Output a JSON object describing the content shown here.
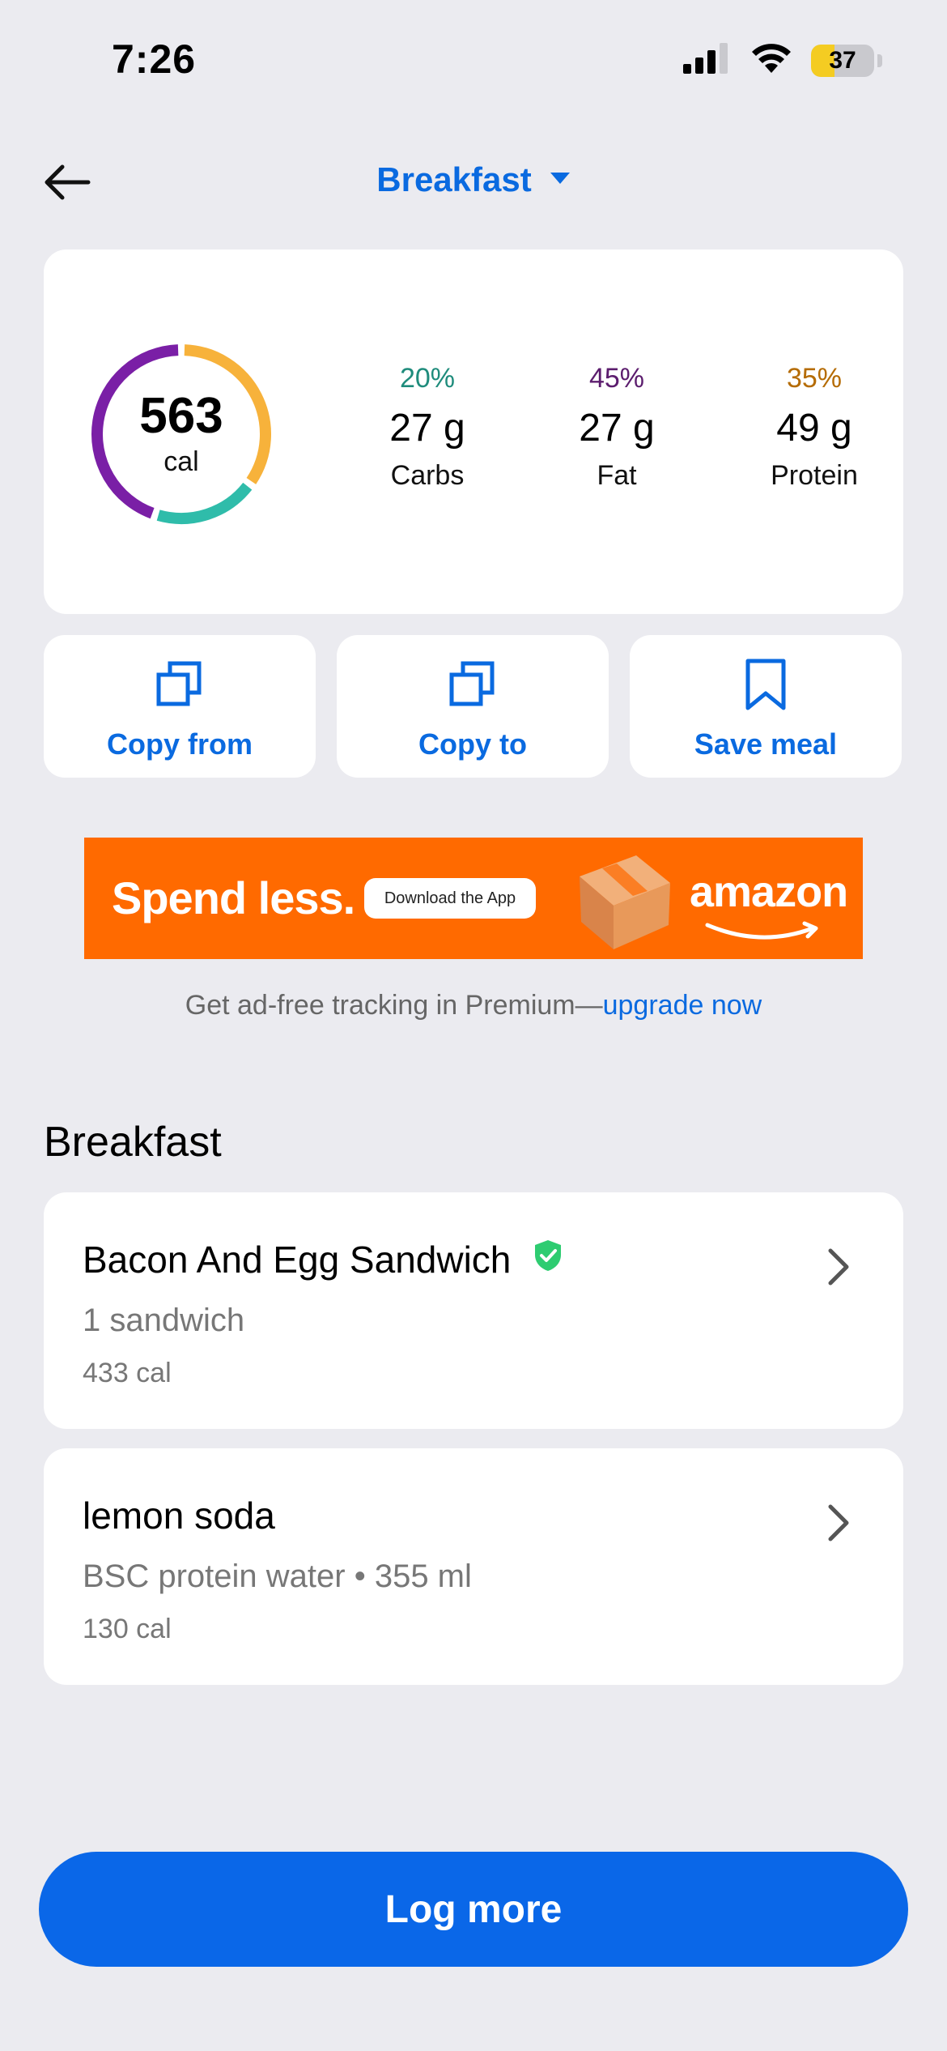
{
  "status_bar": {
    "time": "7:26",
    "battery": "37",
    "battery_fraction": 0.37
  },
  "header": {
    "meal_label": "Breakfast",
    "back_icon": "arrow-left-icon",
    "dropdown_icon": "caret-down-icon"
  },
  "summary": {
    "calories": "563",
    "calories_unit": "cal",
    "macros": [
      {
        "percent": "20%",
        "grams": "27 g",
        "name": "Carbs",
        "color": "#1f8c7c",
        "ring_color": "#2fbcaa",
        "fraction": 0.2
      },
      {
        "percent": "45%",
        "grams": "27 g",
        "name": "Fat",
        "color": "#5c1d6e",
        "ring_color": "#7a1fa6",
        "fraction": 0.45
      },
      {
        "percent": "35%",
        "grams": "49 g",
        "name": "Protein",
        "color": "#b56c05",
        "ring_color": "#f7b23b",
        "fraction": 0.35
      }
    ]
  },
  "actions": {
    "copy_from": "Copy from",
    "copy_to": "Copy to",
    "save_meal": "Save meal"
  },
  "ad": {
    "headline": "Spend less.",
    "cta": "Download the App",
    "brand": "amazon"
  },
  "premium": {
    "text": "Get ad-free tracking in Premium—",
    "link": "upgrade now"
  },
  "section": {
    "title": "Breakfast"
  },
  "foods": [
    {
      "name": "Bacon And Egg Sandwich",
      "serving": "1 sandwich",
      "calories": "433 cal",
      "verified": true
    },
    {
      "name": "lemon soda",
      "serving": "BSC protein water • 355 ml",
      "calories": "130 cal",
      "verified": false
    }
  ],
  "log_more": "Log more",
  "colors": {
    "accent": "#0a6ae0",
    "verified": "#2ecc71",
    "ad_background": "#ff6a00"
  }
}
